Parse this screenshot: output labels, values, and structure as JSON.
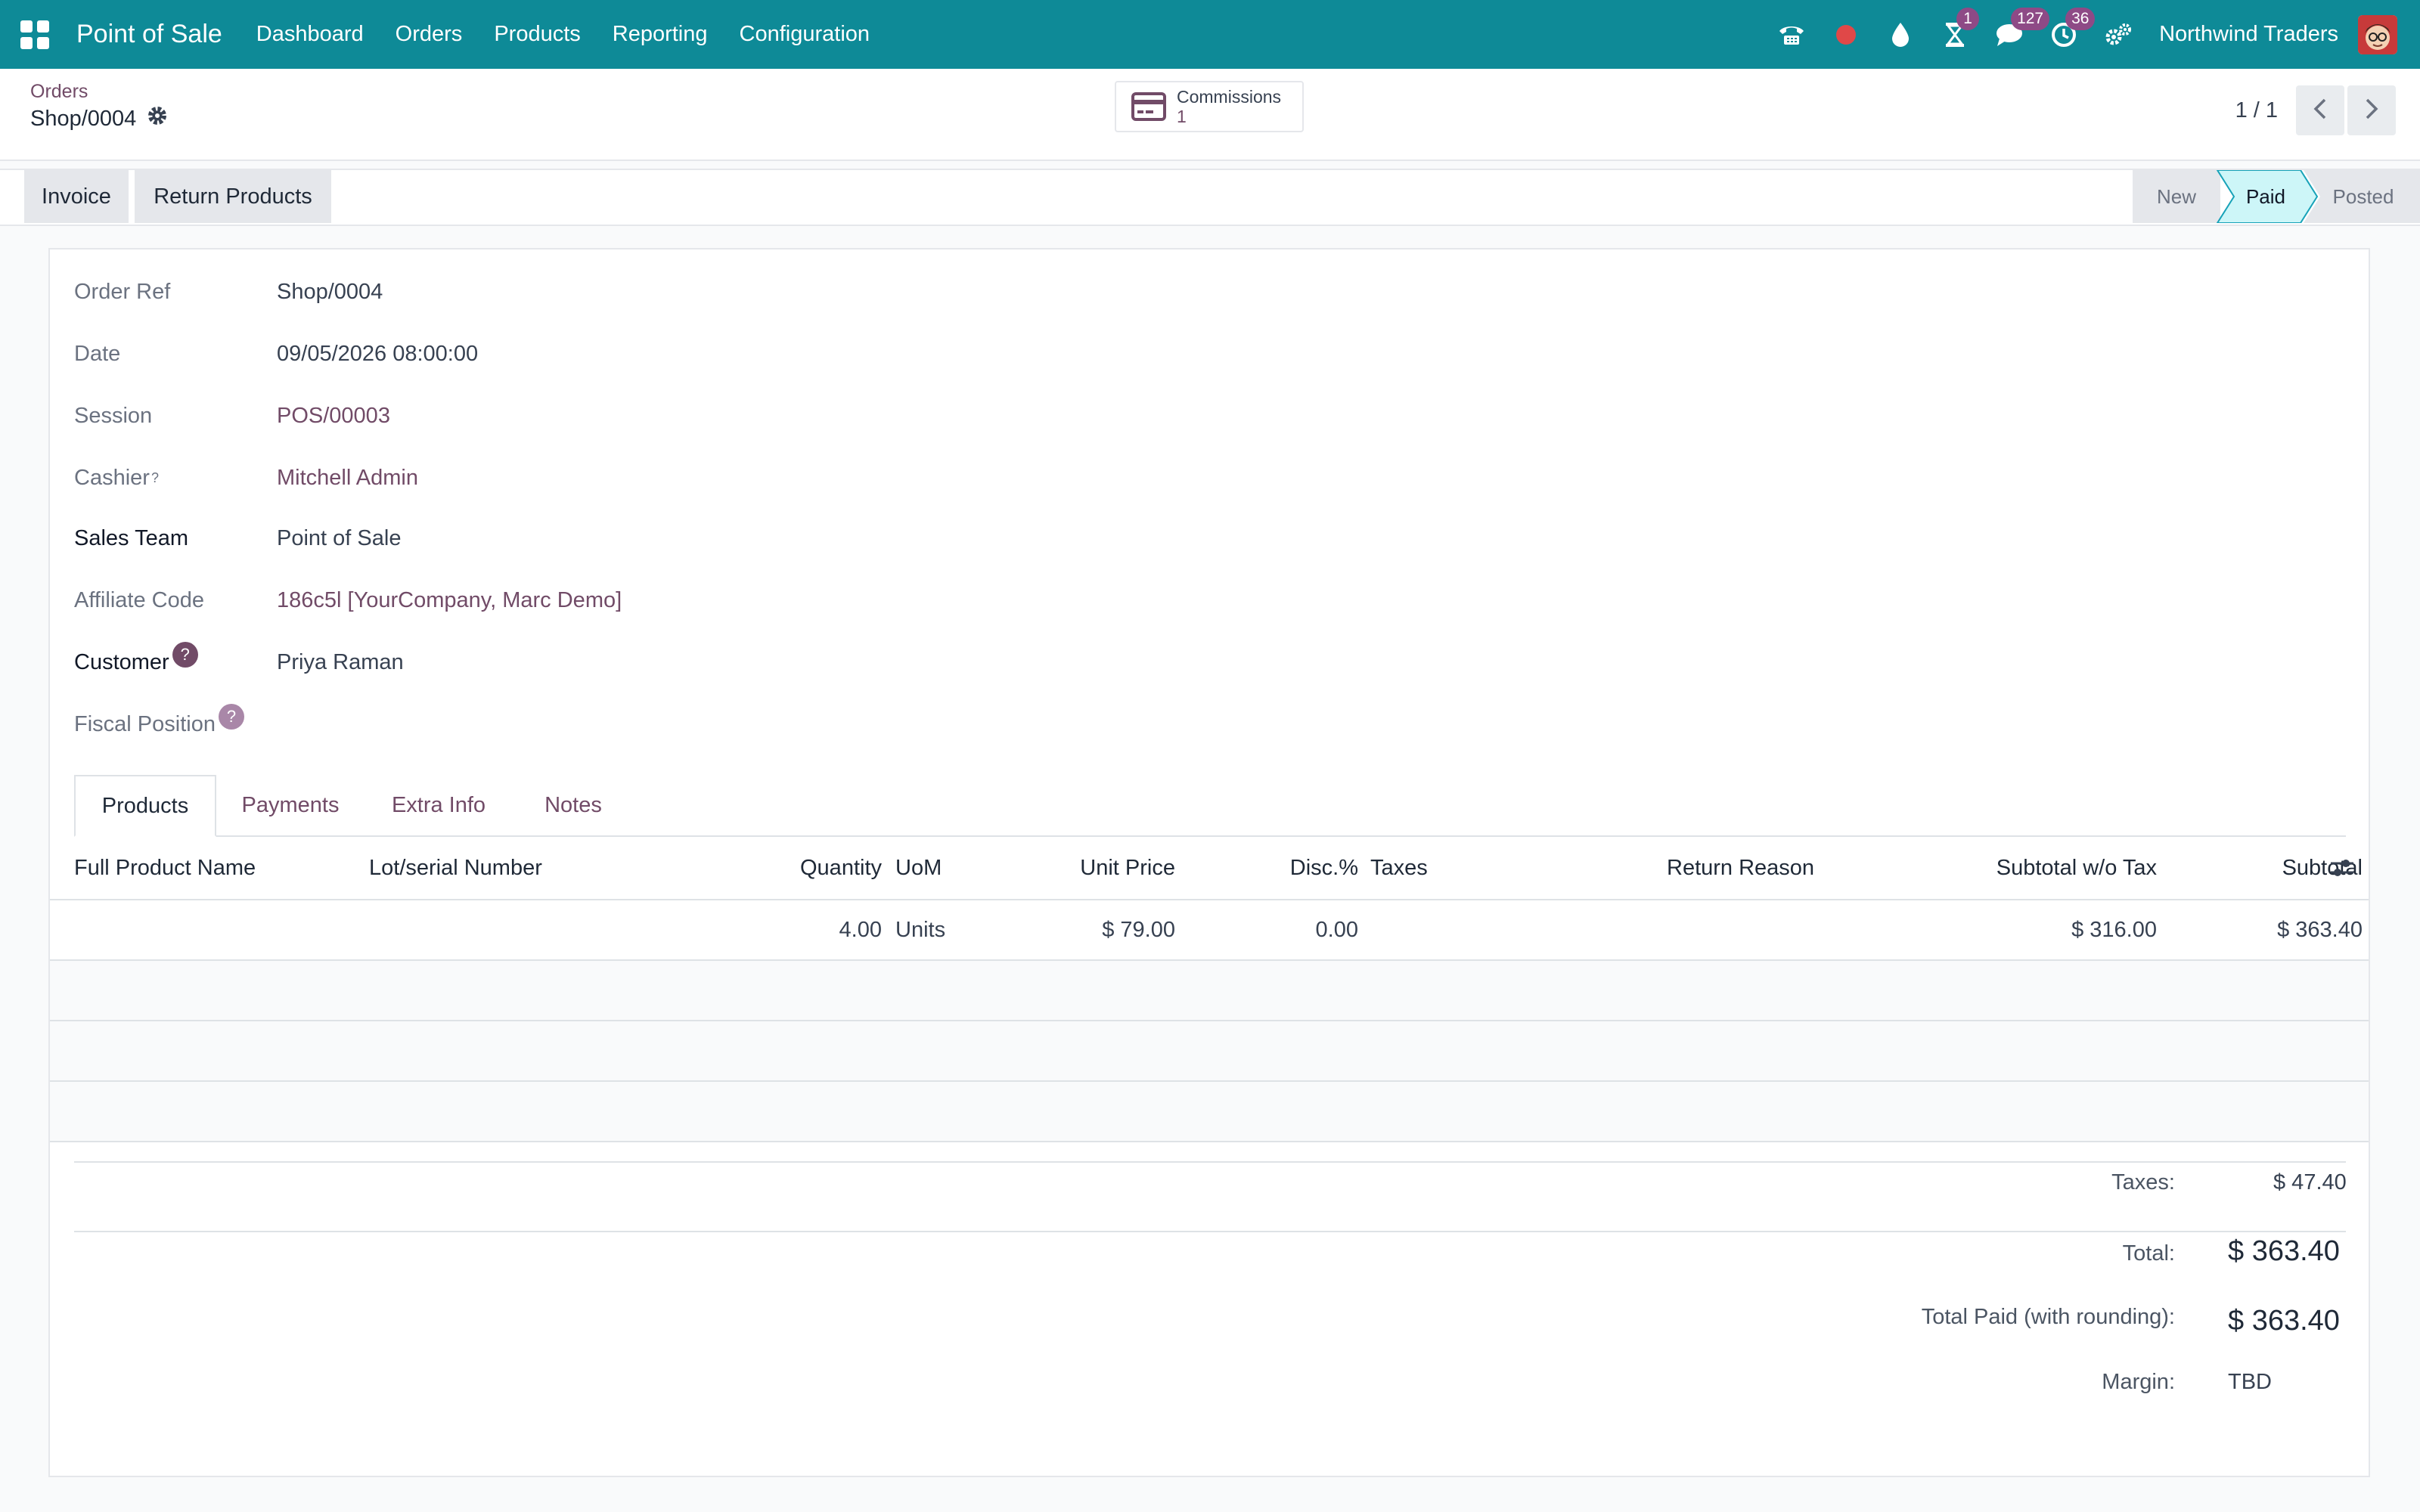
{
  "navbar": {
    "app_name": "Point of Sale",
    "menu": [
      "Dashboard",
      "Orders",
      "Products",
      "Reporting",
      "Configuration"
    ],
    "activity_badge": "1",
    "messages_badge": "127",
    "clock_badge": "36",
    "company": "Northwind Traders"
  },
  "breadcrumb": {
    "parent": "Orders",
    "current": "Shop/0004"
  },
  "smart_button": {
    "label": "Commissions",
    "count": "1"
  },
  "pager": {
    "value": "1 / 1"
  },
  "actions": {
    "invoice": "Invoice",
    "return_products": "Return Products"
  },
  "stages": {
    "new": "New",
    "paid": "Paid",
    "posted": "Posted",
    "current": "Paid"
  },
  "fields": {
    "order_ref": {
      "label": "Order Ref",
      "value": "Shop/0004"
    },
    "date": {
      "label": "Date",
      "value": "09/05/2026 08:00:00"
    },
    "session": {
      "label": "Session",
      "value": "POS/00003"
    },
    "cashier": {
      "label": "Cashier",
      "sup": "?",
      "value": "Mitchell Admin"
    },
    "sales_team": {
      "label": "Sales Team",
      "value": "Point of Sale"
    },
    "affiliate_code": {
      "label": "Affiliate Code",
      "value": "186c5l [YourCompany, Marc Demo]"
    },
    "customer": {
      "label": "Customer",
      "help": "?",
      "value": "Priya Raman"
    },
    "fiscal_position": {
      "label": "Fiscal Position",
      "help": "?",
      "value": ""
    }
  },
  "tabs": {
    "products": "Products",
    "payments": "Payments",
    "extra_info": "Extra Info",
    "notes": "Notes"
  },
  "table": {
    "headers": {
      "product": "Full Product Name",
      "lot": "Lot/serial Number",
      "quantity": "Quantity",
      "uom": "UoM",
      "unit_price": "Unit Price",
      "discount": "Disc.%",
      "taxes": "Taxes",
      "return_reason": "Return Reason",
      "subtotal_wo_tax": "Subtotal w/o Tax",
      "subtotal": "Subtotal"
    },
    "rows": [
      {
        "product": "",
        "lot": "",
        "quantity": "4.00",
        "uom": "Units",
        "unit_price": "$ 79.00",
        "discount": "0.00",
        "taxes": "",
        "return_reason": "",
        "subtotal_wo_tax": "$ 316.00",
        "subtotal": "$ 363.40"
      }
    ]
  },
  "totals": {
    "taxes_label": "Taxes:",
    "taxes": "$ 47.40",
    "total_label": "Total:",
    "total": "$ 363.40",
    "paid_label": "Total Paid (with rounding):",
    "paid": "$ 363.40",
    "margin_label": "Margin:",
    "margin": "TBD"
  },
  "colors": {
    "navbar": "#0e8a97",
    "link": "#714b67",
    "badge": "#8e4a86",
    "active_stage": "#cdf6f8",
    "record_dot": "#e04848"
  },
  "icons": {
    "apps": "apps-grid-icon",
    "settings": "gear-icon",
    "phone": "phone-icon",
    "record": "record-dot-icon",
    "drop": "water-drop-icon",
    "activity": "hourglass-icon",
    "messages": "chat-icon",
    "clock": "clock-icon",
    "debug": "debug-gears-icon",
    "commissions": "credit-card-icon",
    "optional_columns": "sliders-icon"
  }
}
